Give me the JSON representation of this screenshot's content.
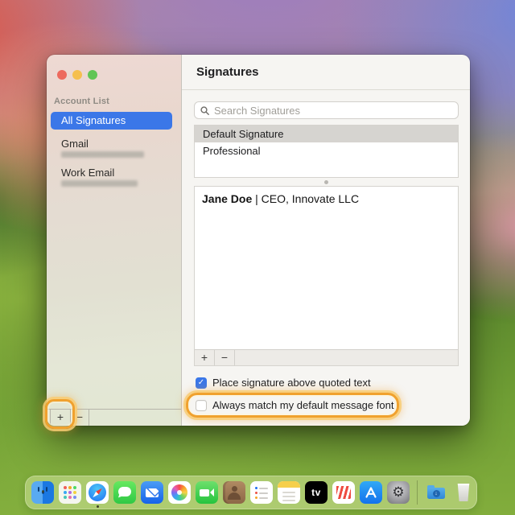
{
  "window": {
    "title": "Signatures",
    "traffic_lights": [
      "#ed6a5e",
      "#f5bf4f",
      "#61c555"
    ],
    "sidebar": {
      "header": "Account List",
      "items": [
        {
          "label": "All Signatures",
          "selected": true,
          "email_redacted": false
        },
        {
          "label": "Gmail",
          "selected": false,
          "email_redacted": true
        },
        {
          "label": "Work Email",
          "selected": false,
          "email_redacted": true
        }
      ],
      "footer": {
        "add_label": "+",
        "remove_label": "−"
      }
    },
    "main": {
      "search": {
        "placeholder": "Search Signatures",
        "icon": "magnifier"
      },
      "signature_list": [
        {
          "name": "Default Signature",
          "selected": true
        },
        {
          "name": "Professional",
          "selected": false
        }
      ],
      "editor": {
        "signature_name": "Jane Doe",
        "signature_rest": " | CEO, Innovate LLC",
        "toolbar": {
          "add_label": "+",
          "remove_label": "−"
        }
      },
      "checkboxes": [
        {
          "label": "Place signature above quoted text",
          "checked": true,
          "highlighted": false
        },
        {
          "label": "Always match my default message font",
          "checked": false,
          "highlighted": true
        }
      ]
    }
  },
  "annotations": {
    "highlight_color": "#f0a12e",
    "highlighted_elements": [
      "sidebar-add-button",
      "always-match-font-checkbox-row"
    ]
  },
  "colors": {
    "accent_blue": "#3b77e8",
    "selected_row_gray": "#d6d4d0",
    "panel_bg": "#f6f5f2"
  },
  "dock": {
    "appletv_label": "tv",
    "running_apps": [
      "finder",
      "safari"
    ],
    "apps": [
      {
        "name": "finder",
        "running": true
      },
      {
        "name": "launchpad",
        "running": false
      },
      {
        "name": "safari",
        "running": true
      },
      {
        "name": "messages",
        "running": false
      },
      {
        "name": "mail",
        "running": false
      },
      {
        "name": "photos",
        "running": false
      },
      {
        "name": "facetime",
        "running": false
      },
      {
        "name": "contacts",
        "running": false
      },
      {
        "name": "reminders",
        "running": false
      },
      {
        "name": "notes",
        "running": false
      },
      {
        "name": "apple-tv",
        "running": false
      },
      {
        "name": "news",
        "running": false
      },
      {
        "name": "app-store",
        "running": false
      },
      {
        "name": "system-settings",
        "running": false
      },
      {
        "name": "downloads-folder",
        "running": false
      },
      {
        "name": "trash",
        "running": false
      }
    ]
  }
}
